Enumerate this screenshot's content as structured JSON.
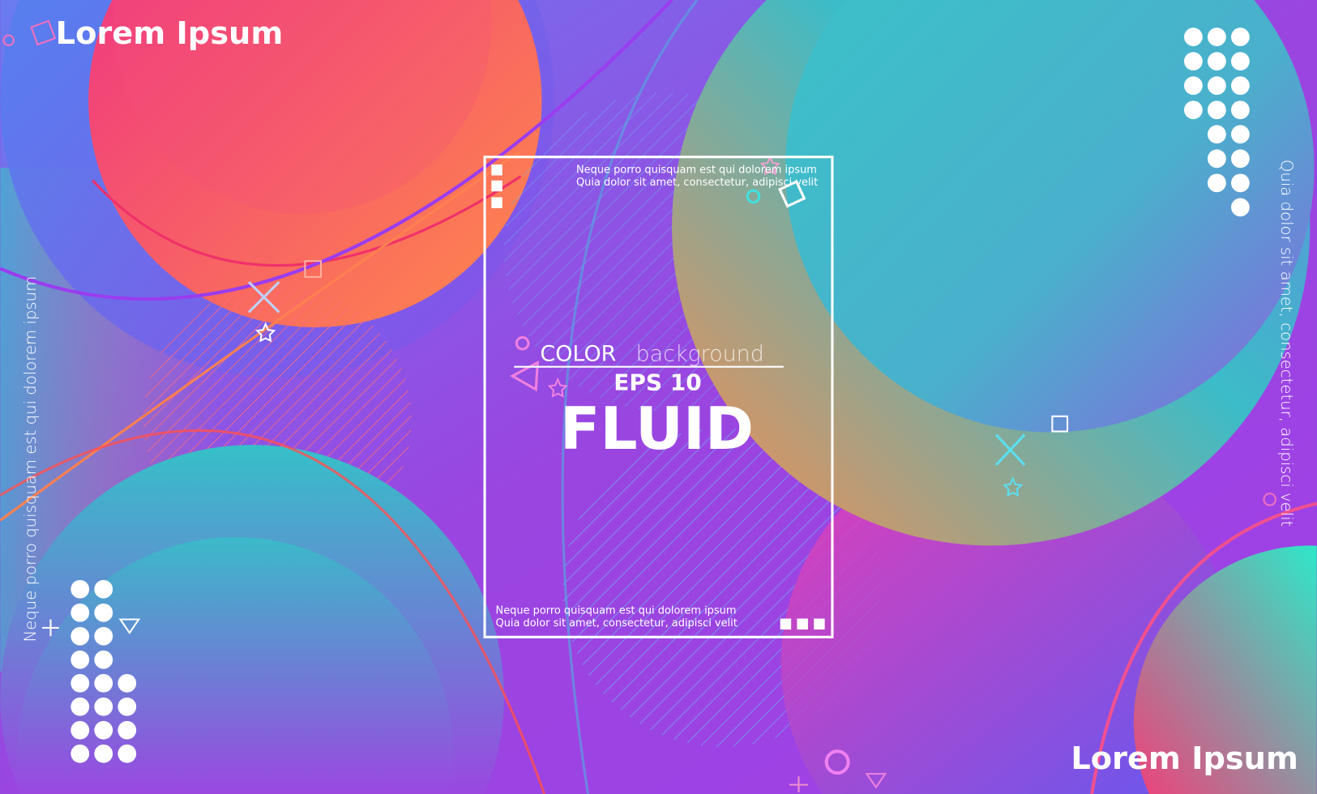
{
  "corner_titles": {
    "top_left": "Lorem Ipsum",
    "bottom_right": "Lorem Ipsum"
  },
  "side_text": {
    "left": "Neque porro quisquam est qui dolorem ipsum",
    "right": "Quia dolor sit amet, consectetur, adipisci velit"
  },
  "frame": {
    "top_lines": [
      "Neque porro quisquam est qui dolorem ipsum",
      "Quia dolor sit amet, consectetur, adipisci velit"
    ],
    "bottom_lines": [
      "Neque porro quisquam est qui dolorem ipsum",
      "Quia dolor sit amet, consectetur, adipisci velit"
    ],
    "color_word": "COLOR",
    "background_word": "background",
    "eps": "EPS 10",
    "headline": "FLUID"
  },
  "colors": {
    "background": "#8a4fe0",
    "pink": "#f0307a",
    "orange": "#ff8a4a",
    "teal": "#2ec8c8",
    "blue": "#5a6cf0",
    "magenta": "#e83ad0"
  }
}
